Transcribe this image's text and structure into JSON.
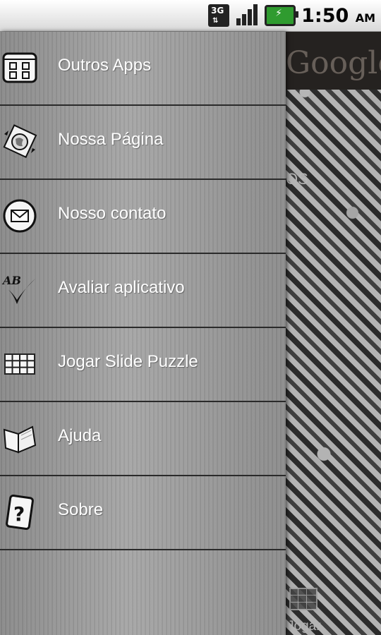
{
  "status_bar": {
    "network": "3G",
    "time": "1:50",
    "ampm": "AM"
  },
  "background_app": {
    "logo_text": "Google",
    "partial_text": "OS",
    "bottom_label": "Jogar"
  },
  "drawer": {
    "items": [
      {
        "label": "Outros Apps",
        "icon": "apps-grid-icon"
      },
      {
        "label": "Nossa Página",
        "icon": "globe-icon"
      },
      {
        "label": "Nosso contato",
        "icon": "envelope-icon"
      },
      {
        "label": "Avaliar aplicativo",
        "icon": "rate-checkmark-icon"
      },
      {
        "label": "Jogar Slide Puzzle",
        "icon": "puzzle-grid-icon"
      },
      {
        "label": "Ajuda",
        "icon": "book-icon"
      },
      {
        "label": "Sobre",
        "icon": "question-card-icon"
      }
    ]
  },
  "colors": {
    "drawer_gray": "#9a9a9a",
    "status_bar_white": "#ffffff",
    "battery_green": "#2f9b2f"
  }
}
